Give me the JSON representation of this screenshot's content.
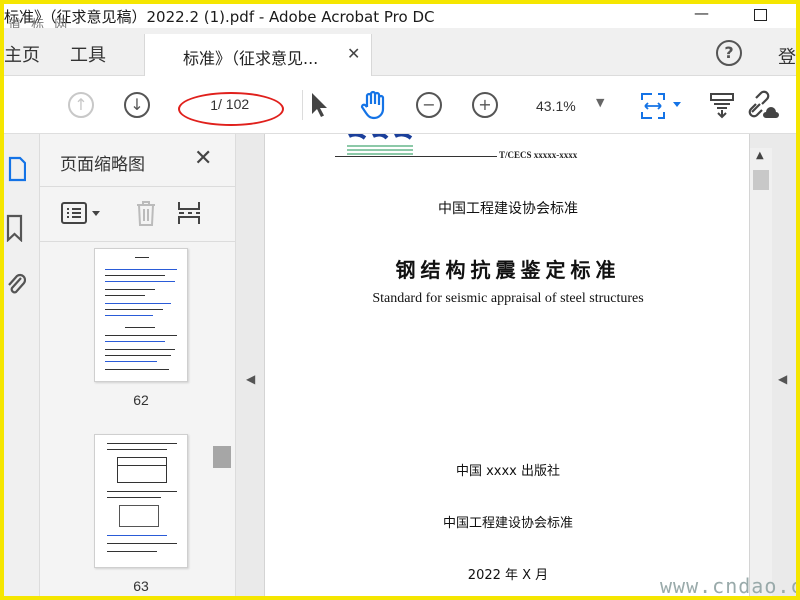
{
  "window": {
    "title": "标准》（征求意见稿）2022.2 (1).pdf - Adobe Acrobat Pro DC",
    "watermark_top": "道 标 网",
    "watermark_bottom": "www.cndao.com"
  },
  "menu": {
    "home": "主页",
    "tools": "工具",
    "doc_tab": "标准》（征求意见...",
    "close_tab": "✕",
    "help": "?",
    "sign_in": "登"
  },
  "toolbar": {
    "page_current": "1",
    "page_total": "/ 102",
    "zoom": "43.1%"
  },
  "thumbnails_panel": {
    "title": "页面缩略图",
    "close": "✕",
    "pages": [
      {
        "number": "62"
      },
      {
        "number": "63"
      }
    ]
  },
  "document": {
    "std_code": "T/CECS xxxxx-xxxx",
    "org_title": "中国工程建设协会标准",
    "cn_title": "钢结构抗震鉴定标准",
    "en_title": "Standard for seismic appraisal of steel structures",
    "publisher": "中国 xxxx 出版社",
    "org_footer": "中国工程建设协会标准",
    "date": "2022 年 X 月"
  },
  "colors": {
    "frame": "#f5e600",
    "annotation": "#e0201c",
    "accent_blue": "#1473e6"
  }
}
